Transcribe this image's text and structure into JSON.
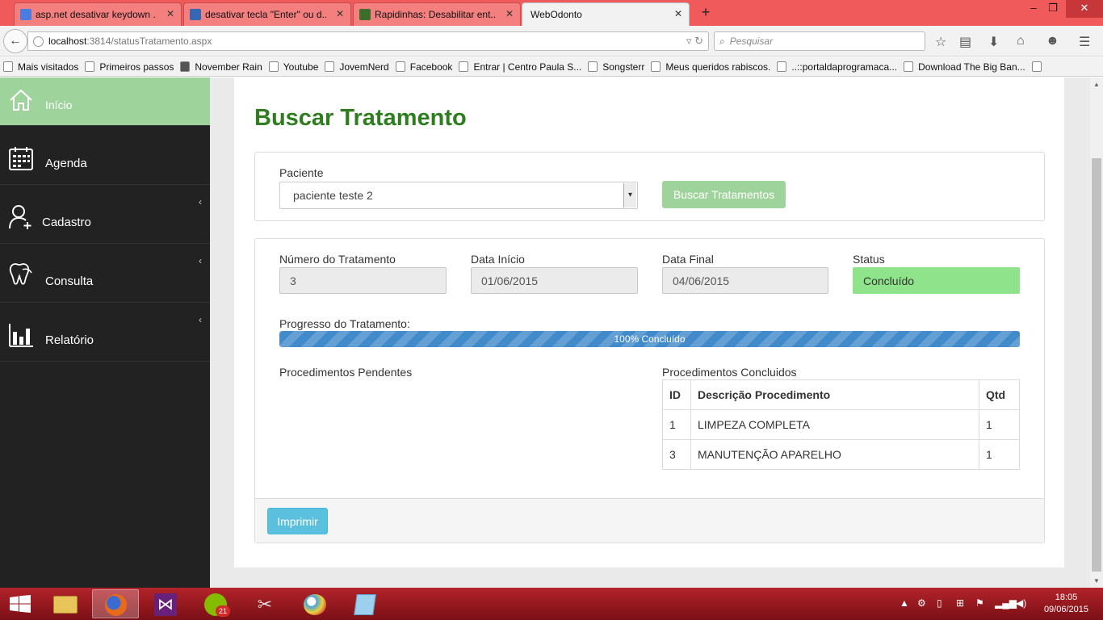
{
  "browser": {
    "tabs": [
      {
        "title": "asp.net desativar keydown ..."
      },
      {
        "title": "desativar tecla \"Enter\" ou d..."
      },
      {
        "title": "Rapidinhas: Desabilitar ent..."
      },
      {
        "title": "WebOdonto"
      }
    ],
    "url_host": "localhost",
    "url_path": ":3814/statusTratamento.aspx",
    "search_placeholder": "Pesquisar",
    "bookmarks": [
      "Mais visitados",
      "Primeiros passos",
      "November Rain",
      "Youtube",
      "JovemNerd",
      "Facebook",
      "Entrar | Centro Paula S...",
      "Songsterr",
      "Meus queridos rabiscos.",
      "..::portaldaprogramaca...",
      "Download The Big Ban..."
    ]
  },
  "sidebar": {
    "items": [
      {
        "label": "Início",
        "icon": "home-icon"
      },
      {
        "label": "Agenda",
        "icon": "calendar-icon"
      },
      {
        "label": "Cadastro",
        "icon": "add-user-icon"
      },
      {
        "label": "Consulta",
        "icon": "tooth-icon"
      },
      {
        "label": "Relatório",
        "icon": "bar-chart-icon"
      }
    ]
  },
  "page": {
    "title": "Buscar Tratamento",
    "search": {
      "patient_label": "Paciente",
      "patient_value": "paciente teste 2",
      "search_button": "Buscar Tratamentos"
    },
    "details": {
      "numero_label": "Número do Tratamento",
      "numero_value": "3",
      "inicio_label": "Data Início",
      "inicio_value": "01/06/2015",
      "final_label": "Data Final",
      "final_value": "04/06/2015",
      "status_label": "Status",
      "status_value": "Concluído",
      "progress_label": "Progresso do Tratamento:",
      "progress_value": 100,
      "progress_text": "100% Concluído",
      "pendentes_label": "Procedimentos Pendentes",
      "concluidos_label": "Procedimentos Concluidos",
      "table_headers": [
        "ID",
        "Descrição Procedimento",
        "Qtd"
      ],
      "table_rows": [
        [
          "1",
          "LIMPEZA COMPLETA",
          "1"
        ],
        [
          "3",
          "MANUTENÇÃO APARELHO",
          "1"
        ]
      ],
      "print_button": "Imprimir"
    }
  },
  "taskbar": {
    "time": "18:05",
    "date": "09/06/2015",
    "spotify_badge": "21"
  },
  "colors": {
    "title_green": "#2e7d1f",
    "sidebar_active": "#9fd39c",
    "status_green": "#8fe38a",
    "progress_blue": "#428bca",
    "print_blue": "#5bc0de"
  }
}
